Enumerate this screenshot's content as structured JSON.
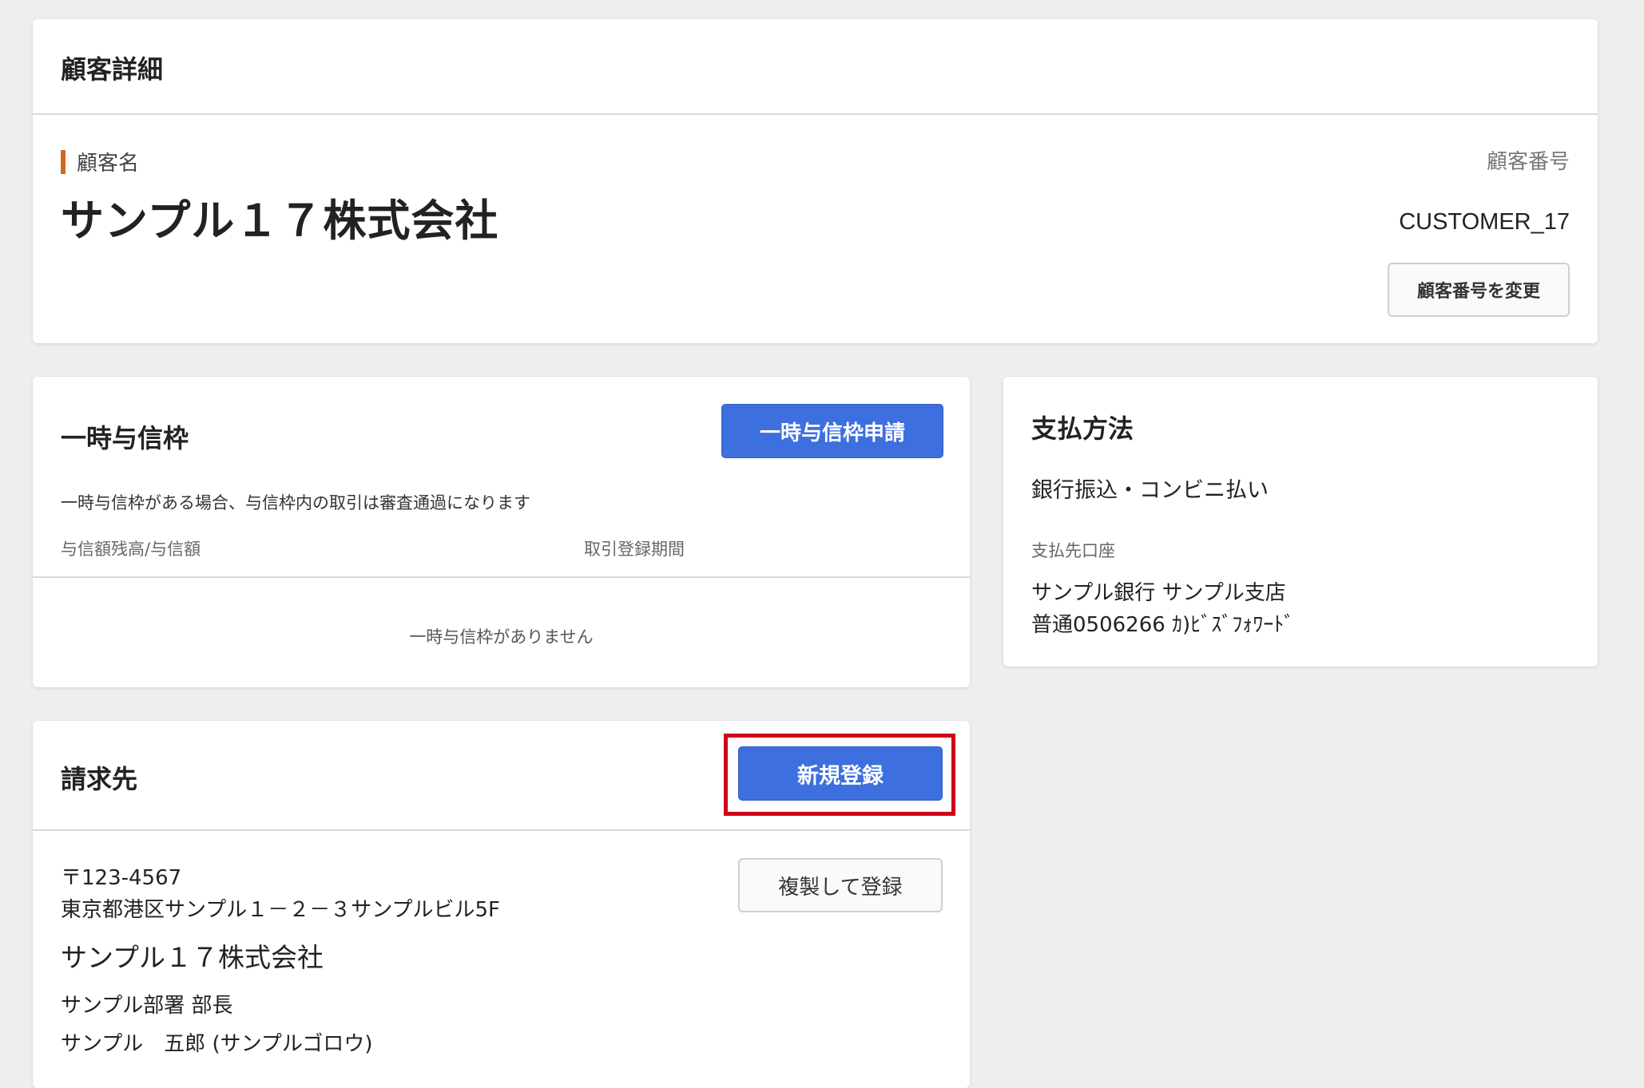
{
  "customer": {
    "header_title": "顧客詳細",
    "name_label": "顧客名",
    "name": "サンプル１７株式会社",
    "number_label": "顧客番号",
    "number": "CUSTOMER_17",
    "change_number_button": "顧客番号を変更"
  },
  "credit": {
    "title": "一時与信枠",
    "apply_button": "一時与信枠申請",
    "note": "一時与信枠がある場合、与信枠内の取引は審査通過になります",
    "columns": [
      "与信額残高/与信額",
      "取引登録期間"
    ],
    "empty_message": "一時与信枠がありません"
  },
  "payment": {
    "title": "支払方法",
    "method": "銀行振込・コンビニ払い",
    "account_label": "支払先口座",
    "account_line1": "サンプル銀行 サンプル支店",
    "account_line2": "普通0506266 ｶ)ﾋﾞｽﾞﾌｫﾜｰﾄﾞ"
  },
  "billing": {
    "title": "請求先",
    "new_button": "新規登録",
    "duplicate_button": "複製して登録",
    "postal": "〒123-4567",
    "address": "東京都港区サンプル１－２－３サンプルビル5F",
    "company": "サンプル１７株式会社",
    "department": "サンプル部署 部長",
    "person": "サンプル　五郎 (サンプルゴロウ)"
  },
  "colors": {
    "primary": "#3d6fdf",
    "highlight": "#d0021b",
    "accent_bar": "#d2691e"
  }
}
